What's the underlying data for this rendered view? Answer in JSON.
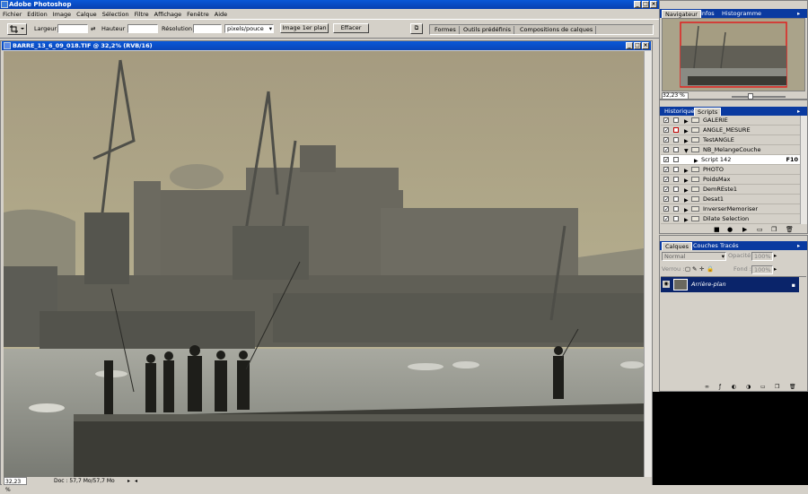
{
  "app": {
    "title": "Adobe Photoshop"
  },
  "menu": [
    "Fichier",
    "Edition",
    "Image",
    "Calque",
    "Sélection",
    "Filtre",
    "Affichage",
    "Fenêtre",
    "Aide"
  ],
  "options": {
    "largeur_label": "Largeur :",
    "hauteur_label": "Hauteur :",
    "resolution_label": "Résolution :",
    "unit_value": "pixels/pouce",
    "image_btn": "Image 1er plan",
    "effacer_btn": "Effacer",
    "well_tabs": [
      "Formes",
      "Outils prédéfinis",
      "Compositions de calques"
    ]
  },
  "document": {
    "title": "BARRE_13_6_09_018.TIF @ 32,2% (RVB/16)",
    "zoom": "32,23 %",
    "doc_info": "Doc : 57,7 Mo/57,7 Mo"
  },
  "navigator": {
    "tabs": [
      "Navigateur",
      "Infos",
      "Histogramme"
    ],
    "zoom": "32,23 %"
  },
  "actions": {
    "tabs": [
      "Historique",
      "Scripts"
    ],
    "items": [
      {
        "label": "GALERIE",
        "type": "folder",
        "red": false
      },
      {
        "label": "ANGLE_MESURE",
        "type": "folder",
        "red": true
      },
      {
        "label": "TestANGLE",
        "type": "folder",
        "red": false
      },
      {
        "label": "NB_MelangeCouche",
        "type": "folder",
        "red": false,
        "open": true
      },
      {
        "label": "Script 142",
        "type": "script",
        "shortcut": "F10"
      },
      {
        "label": "PHOTO",
        "type": "folder",
        "red": false
      },
      {
        "label": "PoidsMax",
        "type": "folder",
        "red": false
      },
      {
        "label": "DemREste1",
        "type": "folder",
        "red": false
      },
      {
        "label": "Desat1",
        "type": "folder",
        "red": false
      },
      {
        "label": "InverserMemoriser",
        "type": "folder",
        "red": false
      },
      {
        "label": "Dilate Selection",
        "type": "folder",
        "red": false
      }
    ]
  },
  "layers": {
    "tabs": [
      "Calques",
      "Couches",
      "Tracés"
    ],
    "blend_mode": "Normal",
    "opacity_label": "Opacité :",
    "opacity_value": "100%",
    "lock_label": "Verrou :",
    "fill_label": "Fond :",
    "fill_value": "100%",
    "layer_name": "Arrière-plan"
  },
  "colors": {
    "titlebar": "#0a4ad0",
    "panel_bg": "#d4d0c8",
    "layer_selected": "#0a246a"
  }
}
